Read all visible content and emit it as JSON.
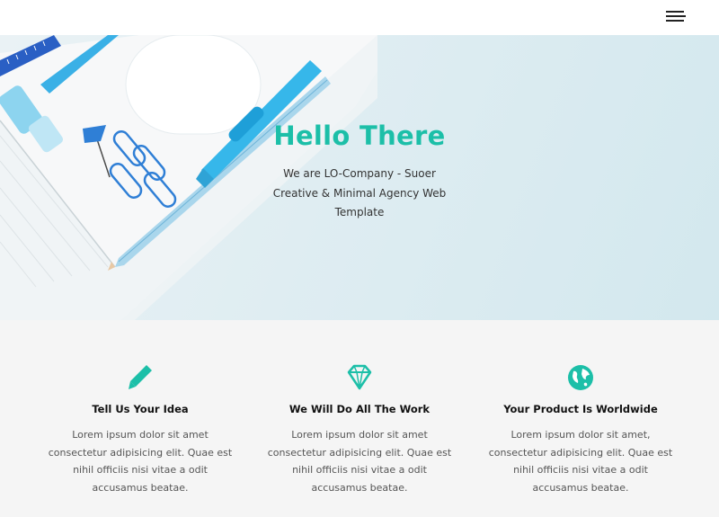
{
  "header": {
    "menu_icon": "hamburger-menu-icon"
  },
  "hero": {
    "title": "Hello There",
    "subtitle": "We are LO-Company - Suoer Creative & Minimal Agency Web Template",
    "title_color": "#1cbfa8"
  },
  "features": [
    {
      "icon": "pencil-icon",
      "title": "Tell Us Your Idea",
      "text": "Lorem ipsum dolor sit amet consectetur adipisicing elit. Quae est nihil officiis nisi vitae a odit accusamus beatae."
    },
    {
      "icon": "diamond-icon",
      "title": "We Will Do All The Work",
      "text": "Lorem ipsum dolor sit amet consectetur adipisicing elit. Quae est nihil officiis nisi vitae a odit accusamus beatae."
    },
    {
      "icon": "globe-icon",
      "title": "Your Product Is Worldwide",
      "text": "Lorem ipsum dolor sit amet, consectetur adipisicing elit. Quae est nihil officiis nisi vitae a odit accusamus beatae."
    }
  ],
  "colors": {
    "accent": "#1cbfa8",
    "hero_bg": "#dfedf2",
    "features_bg": "#f5f5f5"
  }
}
